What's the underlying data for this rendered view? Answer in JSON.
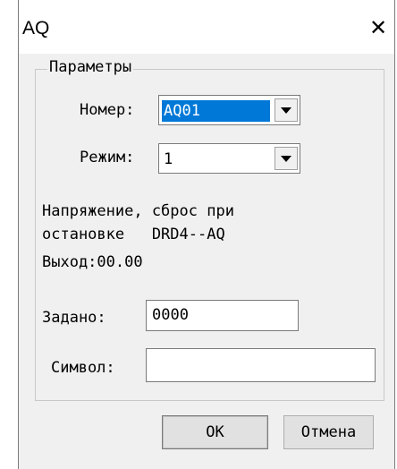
{
  "window": {
    "title": "AQ"
  },
  "group": {
    "legend": "Параметры"
  },
  "number": {
    "label": "Номер:",
    "value": "AQ01"
  },
  "mode": {
    "label": "Режим:",
    "value": "1"
  },
  "description": {
    "line1": "Напряжение, сброс при",
    "line2": "остановке   DRD4--AQ",
    "line3": "Выход:00.00"
  },
  "setpoint": {
    "label": "Задано:",
    "value": "0000"
  },
  "symbol": {
    "label": "Символ:",
    "value": ""
  },
  "buttons": {
    "ok": "OK",
    "cancel": "Отмена"
  },
  "icons": {
    "close": "close-icon",
    "dropdown": "chevron-down-icon"
  }
}
